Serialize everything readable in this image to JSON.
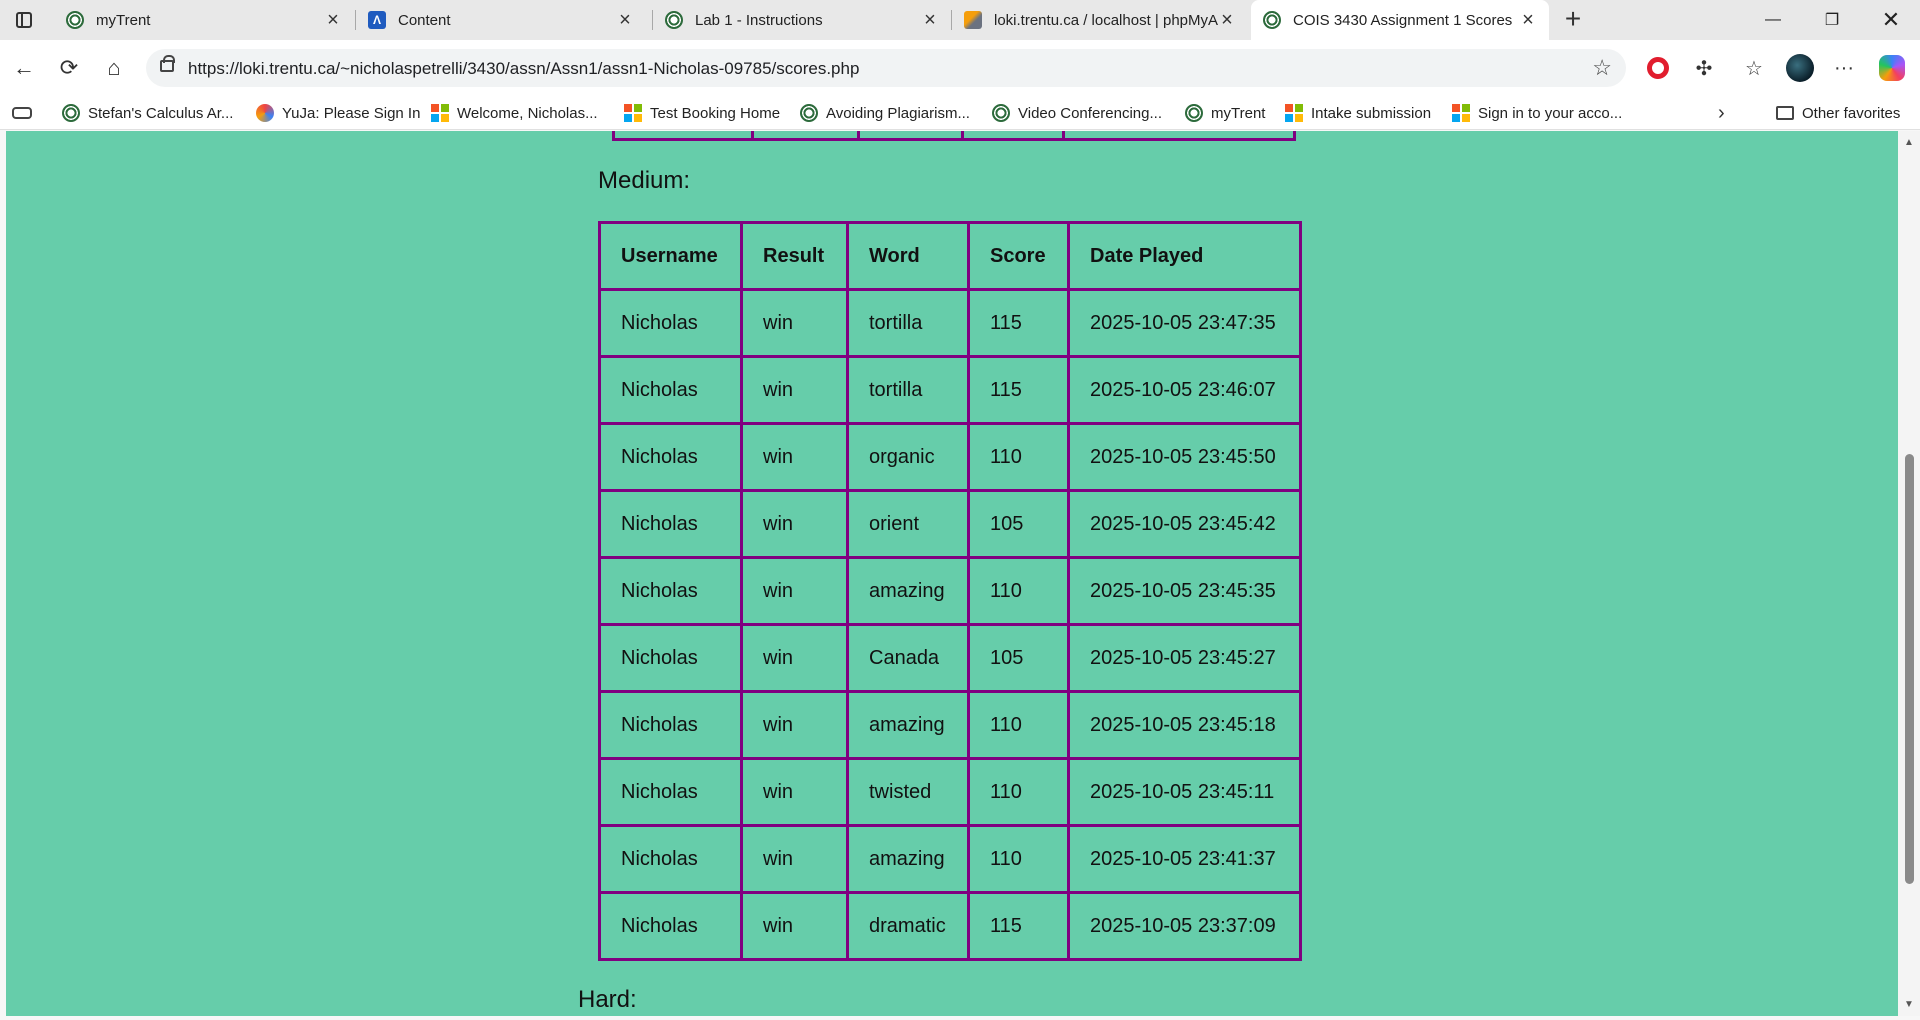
{
  "tabs": [
    {
      "title": "myTrent",
      "icon": "trent-icon"
    },
    {
      "title": "Content",
      "icon": "d2l-icon"
    },
    {
      "title": "Lab 1 - Instructions",
      "icon": "trent-icon"
    },
    {
      "title": "loki.trentu.ca / localhost | phpMyA",
      "icon": "phpmyadmin-icon"
    },
    {
      "title": "COIS 3430 Assignment 1 Scores",
      "icon": "trent-icon",
      "active": true
    }
  ],
  "address": {
    "url": "https://loki.trentu.ca/~nicholaspetrelli/3430/assn/Assn1/assn1-Nicholas-09785/scores.php"
  },
  "favorites": [
    {
      "label": "Stefan's Calculus Ar...",
      "icon": "trent-icon"
    },
    {
      "label": "YuJa: Please Sign In",
      "icon": "yuja-icon"
    },
    {
      "label": "Welcome, Nicholas...",
      "icon": "microsoft-icon"
    },
    {
      "label": "Test Booking Home",
      "icon": "microsoft-icon"
    },
    {
      "label": "Avoiding Plagiarism...",
      "icon": "trent-icon"
    },
    {
      "label": "Video Conferencing...",
      "icon": "trent-icon"
    },
    {
      "label": "myTrent",
      "icon": "trent-icon"
    },
    {
      "label": "Intake submission",
      "icon": "microsoft-icon"
    },
    {
      "label": "Sign in to your acco...",
      "icon": "microsoft-icon"
    }
  ],
  "other_favorites": "Other favorites",
  "page": {
    "background": "#66cdaa",
    "border_color": "#800080",
    "medium_heading": "Medium:",
    "hard_heading": "Hard:",
    "columns": [
      "Username",
      "Result",
      "Word",
      "Score",
      "Date Played"
    ],
    "rows": [
      [
        "Nicholas",
        "win",
        "tortilla",
        "115",
        "2025-10-05 23:47:35"
      ],
      [
        "Nicholas",
        "win",
        "tortilla",
        "115",
        "2025-10-05 23:46:07"
      ],
      [
        "Nicholas",
        "win",
        "organic",
        "110",
        "2025-10-05 23:45:50"
      ],
      [
        "Nicholas",
        "win",
        "orient",
        "105",
        "2025-10-05 23:45:42"
      ],
      [
        "Nicholas",
        "win",
        "amazing",
        "110",
        "2025-10-05 23:45:35"
      ],
      [
        "Nicholas",
        "win",
        "Canada",
        "105",
        "2025-10-05 23:45:27"
      ],
      [
        "Nicholas",
        "win",
        "amazing",
        "110",
        "2025-10-05 23:45:18"
      ],
      [
        "Nicholas",
        "win",
        "twisted",
        "110",
        "2025-10-05 23:45:11"
      ],
      [
        "Nicholas",
        "win",
        "amazing",
        "110",
        "2025-10-05 23:41:37"
      ],
      [
        "Nicholas",
        "win",
        "dramatic",
        "115",
        "2025-10-05 23:37:09"
      ]
    ]
  }
}
